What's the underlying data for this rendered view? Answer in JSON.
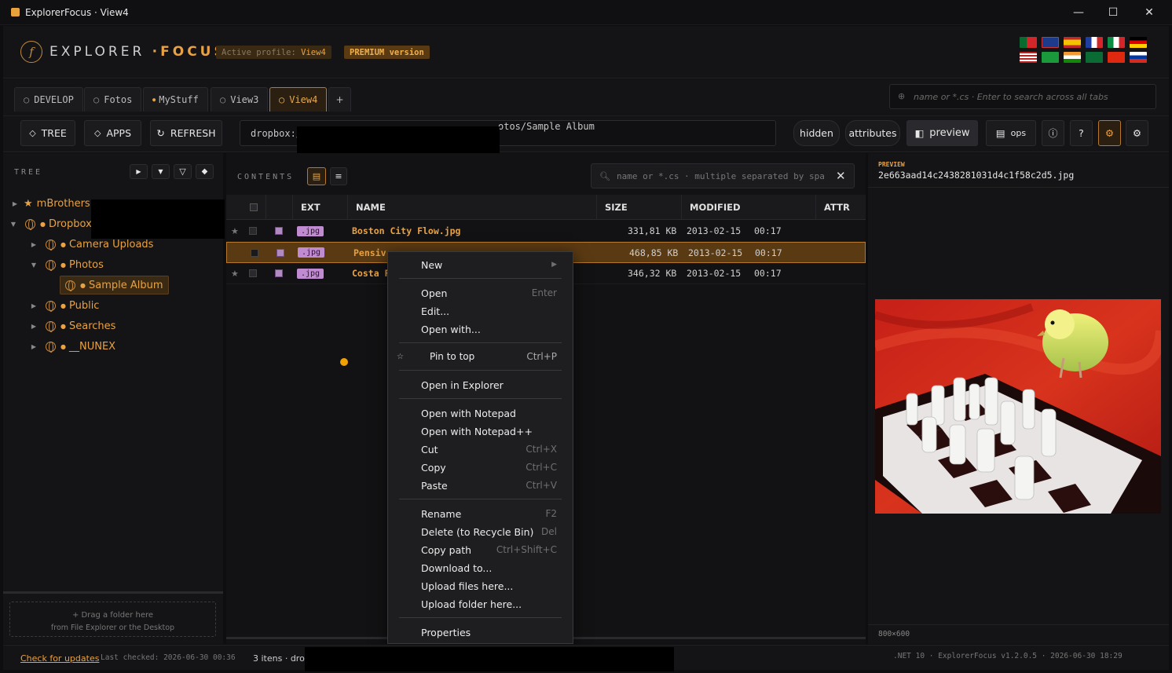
{
  "window": {
    "title": "ExplorerFocus · View4",
    "controls": [
      "minimize",
      "maximize",
      "close"
    ]
  },
  "header": {
    "brand_left": "EXPLORER",
    "brand_dot": "·",
    "brand_right": "FOCUS",
    "profile_label": "Active profile:",
    "profile_value": "View4",
    "premium": "PREMIUM version",
    "flags": [
      "Portuguese",
      "English UK",
      "Spanish",
      "French",
      "Italian",
      "German",
      "English US",
      "Portuguese BR",
      "Hindi",
      "Arabic",
      "Chinese",
      "Russian"
    ]
  },
  "tabs": [
    {
      "label": "DEVELOP",
      "marker": "○"
    },
    {
      "label": "Fotos",
      "marker": "○"
    },
    {
      "label": "MyStuff",
      "marker": "●"
    },
    {
      "label": "View3",
      "marker": "○"
    },
    {
      "label": "View4",
      "marker": "○",
      "active": true
    }
  ],
  "add_tab": "+",
  "search_all": {
    "placeholder": "name or *.cs · Enter to search across all tabs"
  },
  "toolbar": {
    "tree": "TREE",
    "apps": "APPS",
    "refresh": "REFRESH",
    "path_start": "dropbox:/",
    "path_end": "otos/Sample Album",
    "hidden": "hidden",
    "attributes": "attributes",
    "preview": "preview",
    "ops": "ops",
    "help": "?"
  },
  "tree": {
    "title": "TREE",
    "items": [
      {
        "label": "mBrothers",
        "icon": "star-icon",
        "depth": 0,
        "expanded": false
      },
      {
        "label": "Dropbox",
        "icon": "globe-icon",
        "depth": 0,
        "expanded": true
      },
      {
        "label": "Camera Uploads",
        "icon": "globe-icon",
        "depth": 1,
        "expanded": false
      },
      {
        "label": "Photos",
        "icon": "globe-icon",
        "depth": 1,
        "expanded": true
      },
      {
        "label": "Sample Album",
        "icon": "globe-icon",
        "depth": 2,
        "selected": true
      },
      {
        "label": "Public",
        "icon": "globe-icon",
        "depth": 1,
        "expanded": false
      },
      {
        "label": "Searches",
        "icon": "globe-icon",
        "depth": 1,
        "expanded": false
      },
      {
        "label": "__NUNEX",
        "icon": "globe-icon",
        "depth": 1,
        "expanded": false
      }
    ],
    "drop_line1": "+ Drag a folder here",
    "drop_line2": "from File Explorer or the Desktop"
  },
  "contents": {
    "title": "CONTENTS",
    "filter_placeholder": "name or *.cs · multiple separated by spa",
    "columns": {
      "ext": "EXT",
      "name": "NAME",
      "size": "SIZE",
      "modified": "MODIFIED",
      "attr": "ATTR"
    },
    "rows": [
      {
        "ext": ".jpg",
        "name": "Boston City Flow.jpg",
        "size": "331,81 KB",
        "date": "2013-02-15",
        "time": "00:17"
      },
      {
        "ext": ".jpg",
        "name": "Pensiv",
        "size": "468,85 KB",
        "date": "2013-02-15",
        "time": "00:17",
        "selected": true
      },
      {
        "ext": ".jpg",
        "name": "Costa F",
        "size": "346,32 KB",
        "date": "2013-02-15",
        "time": "00:17"
      }
    ]
  },
  "context_menu": {
    "new": "New",
    "open": "Open",
    "open_sc": "Enter",
    "edit": "Edit...",
    "open_with": "Open with...",
    "pin": "Pin to top",
    "pin_sc": "Ctrl+P",
    "open_explorer": "Open in Explorer",
    "open_notepad": "Open with Notepad",
    "open_notepadpp": "Open with Notepad++",
    "cut": "Cut",
    "cut_sc": "Ctrl+X",
    "copy": "Copy",
    "copy_sc": "Ctrl+C",
    "paste": "Paste",
    "paste_sc": "Ctrl+V",
    "rename": "Rename",
    "rename_sc": "F2",
    "delete": "Delete (to Recycle Bin)",
    "delete_sc": "Del",
    "copy_path": "Copy path",
    "copy_path_sc": "Ctrl+Shift+C",
    "download": "Download to...",
    "upload_files": "Upload files here...",
    "upload_folder": "Upload folder here...",
    "properties": "Properties"
  },
  "preview": {
    "label": "PREVIEW",
    "filename": "2e663aad14c2438281031d4c1f58c2d5.jpg",
    "dimensions": "800×600"
  },
  "status": {
    "check_updates": "Check for updates",
    "last_checked": "Last checked: 2026-06-30 00:36",
    "items": "3 itens · drop",
    "right": ".NET 10 · ExplorerFocus v1.2.0.5 · 2026-06-30 18:29"
  },
  "colors": {
    "accent": "#e8a243",
    "selected_row": "#5a3a12",
    "background": "#0e0e10"
  }
}
